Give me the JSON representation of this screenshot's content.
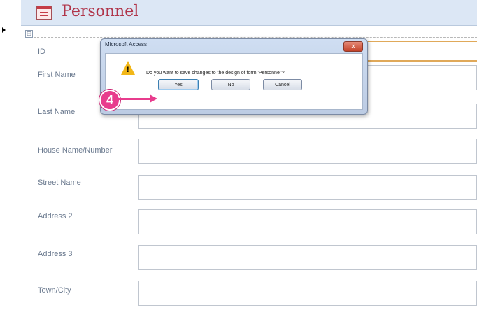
{
  "form": {
    "title": "Personnel",
    "move_handle_glyph": "⊞",
    "fields": [
      {
        "label": "ID"
      },
      {
        "label": "First Name"
      },
      {
        "label": "Last Name"
      },
      {
        "label": "House Name/Number"
      },
      {
        "label": "Street Name"
      },
      {
        "label": "Address 2"
      },
      {
        "label": "Address 3"
      },
      {
        "label": "Town/City"
      }
    ]
  },
  "dialog": {
    "title": "Microsoft Access",
    "close_glyph": "✕",
    "warning_glyph": "!",
    "message": "Do you want to save changes to the design of form 'Personnel'?",
    "yes_label": "Yes",
    "no_label": "No",
    "cancel_label": "Cancel"
  },
  "callout": {
    "number": "4"
  },
  "colors": {
    "callout": "#e83c8d",
    "title": "#b0354a"
  },
  "icons": {
    "form": "form-icon",
    "warning": "warning-icon",
    "close": "close-icon"
  }
}
